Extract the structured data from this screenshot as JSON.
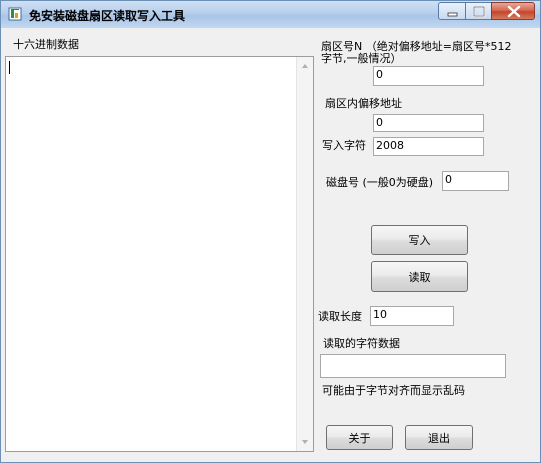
{
  "window": {
    "title": "免安装磁盘扇区读取写入工具",
    "controls": {
      "minimize": "minimize",
      "maximize": "maximize",
      "close": "close"
    }
  },
  "hex_panel": {
    "label": "十六进制数据",
    "value": ""
  },
  "form": {
    "sector_label_line1": "扇区号N （绝对偏移地址=扇区号*512",
    "sector_label_line2": "字节,一般情况）",
    "sector_value": "0",
    "offset_label": "扇区内偏移地址",
    "offset_value": "0",
    "write_chars_label": "写入字符",
    "write_chars_value": "2008",
    "disk_label": "磁盘号 (一般0为硬盘)",
    "disk_value": "0",
    "write_button": "写入",
    "read_button": "读取",
    "read_length_label": "读取长度",
    "read_length_value": "10",
    "read_chars_label": "读取的字符数据",
    "read_chars_value": "",
    "garbled_note": "可能由于字节对齐而显示乱码",
    "about_button": "关于",
    "exit_button": "退出"
  }
}
